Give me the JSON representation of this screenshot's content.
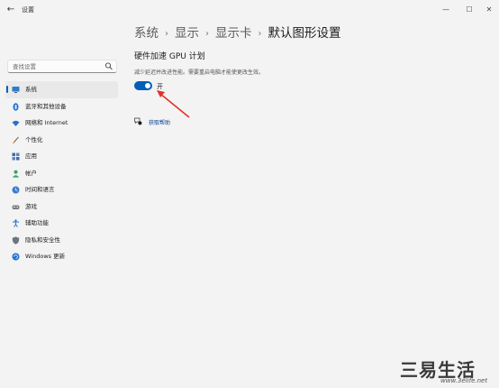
{
  "app": {
    "title": "设置",
    "back_icon": "back-arrow-icon"
  },
  "window_controls": {
    "minimize": "—",
    "maximize": "☐",
    "close": "✕"
  },
  "sidebar": {
    "search_placeholder": "查找设置",
    "items": [
      {
        "label": "系统",
        "icon": "monitor-icon",
        "active": true
      },
      {
        "label": "蓝牙和其他设备",
        "icon": "bluetooth-icon"
      },
      {
        "label": "网络和 Internet",
        "icon": "wifi-icon"
      },
      {
        "label": "个性化",
        "icon": "brush-icon"
      },
      {
        "label": "应用",
        "icon": "apps-icon"
      },
      {
        "label": "帐户",
        "icon": "person-icon"
      },
      {
        "label": "时间和语言",
        "icon": "globe-clock-icon"
      },
      {
        "label": "游戏",
        "icon": "gamepad-icon"
      },
      {
        "label": "辅助功能",
        "icon": "accessibility-icon"
      },
      {
        "label": "隐私和安全性",
        "icon": "shield-icon"
      },
      {
        "label": "Windows 更新",
        "icon": "update-icon"
      }
    ]
  },
  "breadcrumb": [
    "系统",
    "显示",
    "显示卡",
    "默认图形设置"
  ],
  "main": {
    "section_title": "硬件加速 GPU 计划",
    "section_desc": "减少延迟并改进性能。需要重启电脑才能使更改生效。",
    "toggle": {
      "state": "开",
      "on": true
    },
    "help_link": "获取帮助"
  },
  "colors": {
    "accent": "#005fb8",
    "arrow": "#e0312a"
  },
  "watermark": {
    "text": "三易生活",
    "url": "www.3elife.net"
  }
}
